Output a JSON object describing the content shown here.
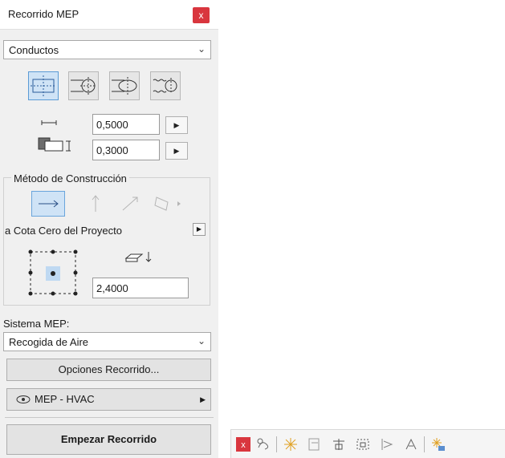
{
  "palette": {
    "title": "Recorrido MEP",
    "close_label": "x",
    "domain_select": {
      "value": "Conductos"
    },
    "shapes": [
      {
        "name": "rectangular",
        "selected": true
      },
      {
        "name": "round",
        "selected": false
      },
      {
        "name": "oval",
        "selected": false
      },
      {
        "name": "flexible",
        "selected": false
      }
    ],
    "width_value": "0,5000",
    "height_value": "0,3000",
    "construction": {
      "label": "Método de Construcción",
      "methods": [
        {
          "name": "horizontal-arrow",
          "selected": true
        },
        {
          "name": "vertical-arrow",
          "selected": false
        },
        {
          "name": "diagonal-arrow",
          "selected": false
        },
        {
          "name": "slope",
          "selected": false
        }
      ],
      "reference_label": "a Cota Cero del Proyecto",
      "elevation_value": "2,4000"
    },
    "system_label": "Sistema MEP:",
    "system_select": {
      "value": "Recogida de Aire"
    },
    "routing_options_label": "Opciones Recorrido...",
    "layer_label": "MEP - HVAC",
    "start_label": "Empezar Recorrido"
  },
  "toolbar": {
    "icons": [
      "close-icon",
      "route-icon",
      "snap-icon",
      "transition-icon",
      "branch-icon",
      "fit-icon",
      "elevation-icon",
      "rotate-icon",
      "settings-icon"
    ]
  },
  "colors": {
    "close_red": "#d9363e",
    "selected_blue": "#cfe3f6",
    "panel_bg": "#f0f0f0"
  }
}
